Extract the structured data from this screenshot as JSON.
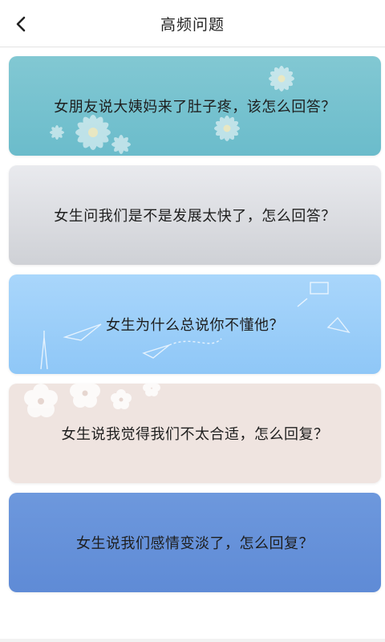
{
  "header": {
    "title": "高频问题",
    "back_icon": "chevron-left-icon"
  },
  "questions": [
    {
      "label": "女朋友说大姨妈来了肚子疼，该怎么回答？",
      "bg": "#76c3cf"
    },
    {
      "label": "女生问我们是不是发展太快了，怎么回答？",
      "bg": "#dcdee2"
    },
    {
      "label": "女生为什么总说你不懂他？",
      "bg": "#9dcff9"
    },
    {
      "label": "女生说我觉得我们不太合适，怎么回复？",
      "bg": "#efe4e0"
    },
    {
      "label": "女生说我们感情变淡了，怎么回复？",
      "bg": "#6592d9"
    }
  ]
}
